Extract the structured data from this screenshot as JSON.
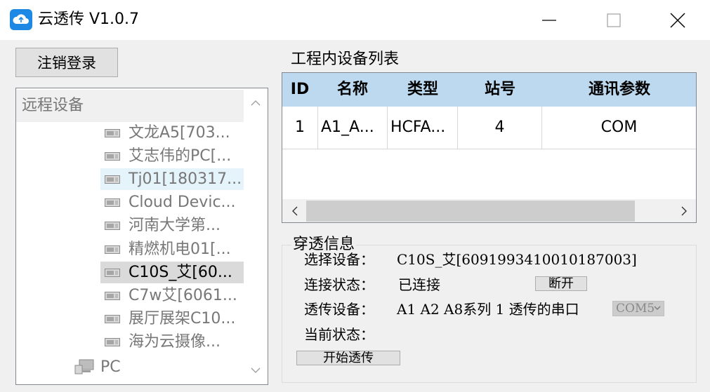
{
  "window": {
    "title": "云透传 V1.0.7",
    "app_icon": "cloud-transfer-icon",
    "controls": [
      "minimize-icon",
      "maximize-icon",
      "close-icon"
    ]
  },
  "logout_label": "注销登录",
  "tree": {
    "root_label": "远程设备",
    "items": [
      {
        "label": "文龙A5[703...",
        "icon": "device-icon",
        "state": "normal"
      },
      {
        "label": "艾志伟的PC[...",
        "icon": "device-icon",
        "state": "normal"
      },
      {
        "label": "Tj01[180317...",
        "icon": "device-icon",
        "state": "hover"
      },
      {
        "label": "Cloud Devic...",
        "icon": "device-icon",
        "state": "normal"
      },
      {
        "label": "河南大学第...",
        "icon": "device-icon",
        "state": "normal"
      },
      {
        "label": "精燃机电01[...",
        "icon": "device-icon",
        "state": "normal"
      },
      {
        "label": "C10S_艾[60...",
        "icon": "device-icon",
        "state": "selected"
      },
      {
        "label": "C7w艾[6061...",
        "icon": "device-icon",
        "state": "normal"
      },
      {
        "label": "展厅展架C10...",
        "icon": "device-icon",
        "state": "normal"
      },
      {
        "label": "海为云摄像...",
        "icon": "device-icon",
        "state": "normal"
      }
    ],
    "pc_label": "PC"
  },
  "device_list": {
    "title": "工程内设备列表",
    "columns": [
      "ID",
      "名称",
      "类型",
      "站号",
      "通讯参数"
    ],
    "rows": [
      [
        "1",
        "A1_A...",
        "HCFA...",
        "4",
        "COM"
      ]
    ]
  },
  "tunnel": {
    "title": "穿透信息",
    "select_label": "选择设备：",
    "select_value": "C10S_艾[6091993410010187003]",
    "status_label": "连接状态：",
    "status_value": "已连接",
    "disconnect_label": "断开",
    "passthrough_label": "透传设备：",
    "passthrough_value": "A1 A2 A8系列 1 透传的串口",
    "port_value": "COM5",
    "current_label": "当前状态：",
    "current_value": "",
    "start_label": "开始透传"
  },
  "colors": {
    "header_bg": "#bdd9ef",
    "selected_bg": "#dadada",
    "hover_bg": "#e5f3fb",
    "icon_blue": "#1e88e5"
  }
}
